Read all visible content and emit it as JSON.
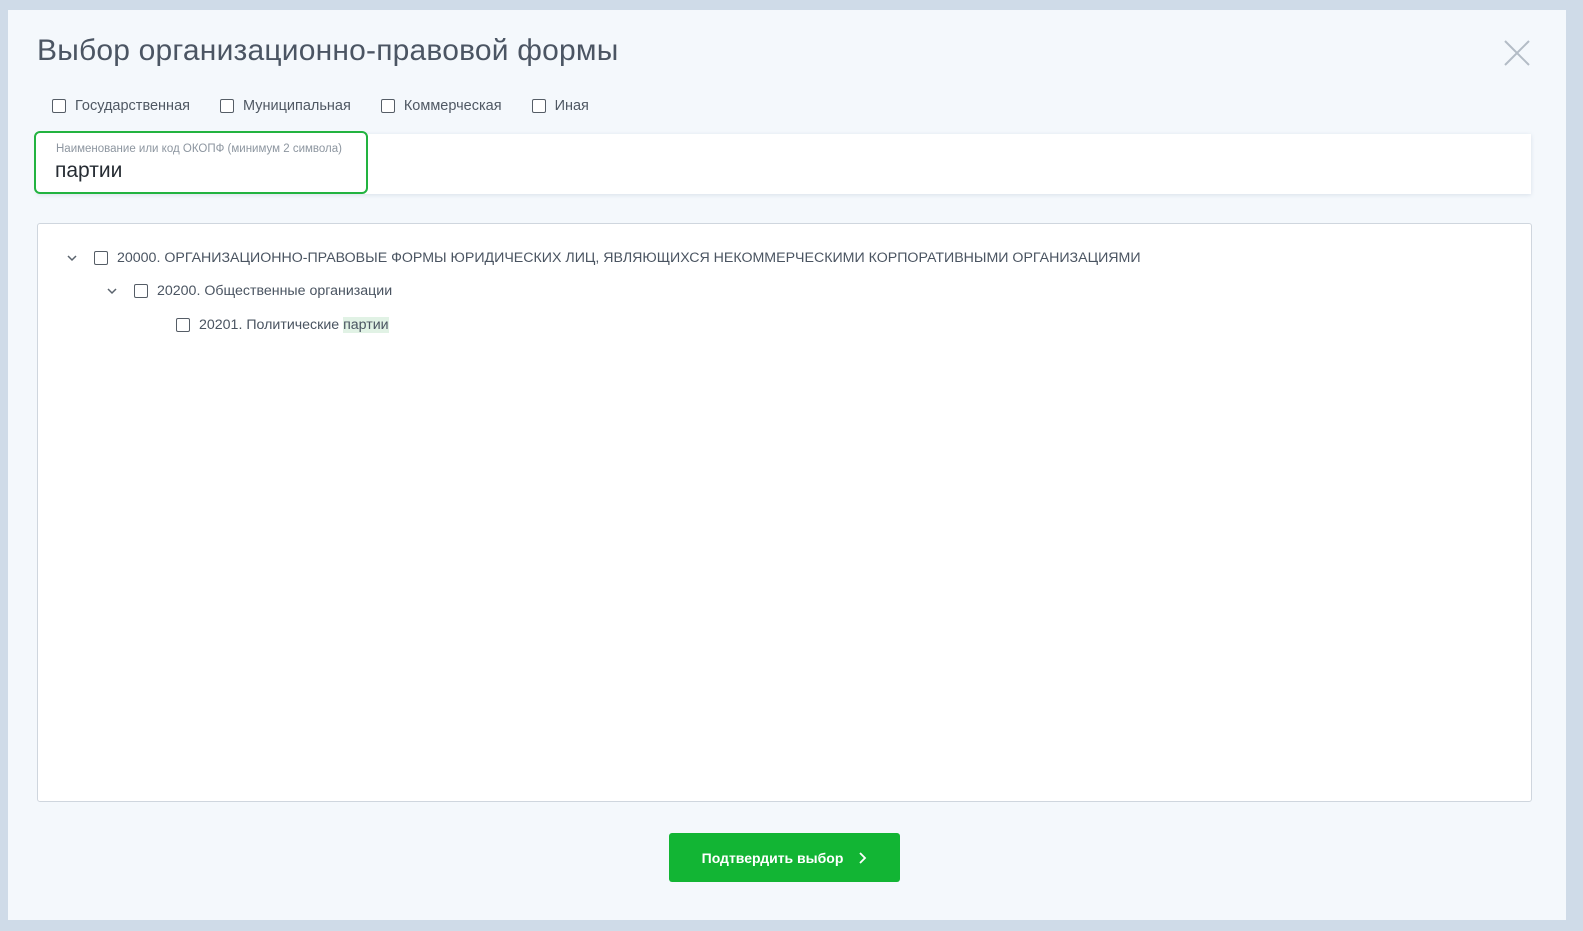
{
  "modal": {
    "title": "Выбор организационно-правовой формы",
    "close_icon": "close-icon"
  },
  "filters": [
    {
      "label": "Государственная",
      "checked": false
    },
    {
      "label": "Муниципальная",
      "checked": false
    },
    {
      "label": "Коммерческая",
      "checked": false
    },
    {
      "label": "Иная",
      "checked": false
    }
  ],
  "search": {
    "label": "Наименование или код ОКОПФ (минимум 2 символа)",
    "value": "партии"
  },
  "tree": {
    "nodes": [
      {
        "level": 0,
        "expanded": true,
        "checked": false,
        "label": "20000. ОРГАНИЗАЦИОННО-ПРАВОВЫЕ ФОРМЫ ЮРИДИЧЕСКИХ ЛИЦ, ЯВЛЯЮЩИХСЯ НЕКОММЕРЧЕСКИМИ КОРПОРАТИВНЫМИ ОРГАНИЗАЦИЯМИ"
      },
      {
        "level": 1,
        "expanded": true,
        "checked": false,
        "label": "20200. Общественные организации"
      },
      {
        "level": 2,
        "expanded": false,
        "checked": false,
        "label_prefix": "20201. Политические ",
        "label_highlight": "партии"
      }
    ]
  },
  "confirm": {
    "label": "Подтвердить выбор",
    "icon": "chevron-right-icon"
  },
  "colors": {
    "accent": "#12b534",
    "focus_border": "#22b340",
    "highlight_bg": "#e1f2e5"
  }
}
